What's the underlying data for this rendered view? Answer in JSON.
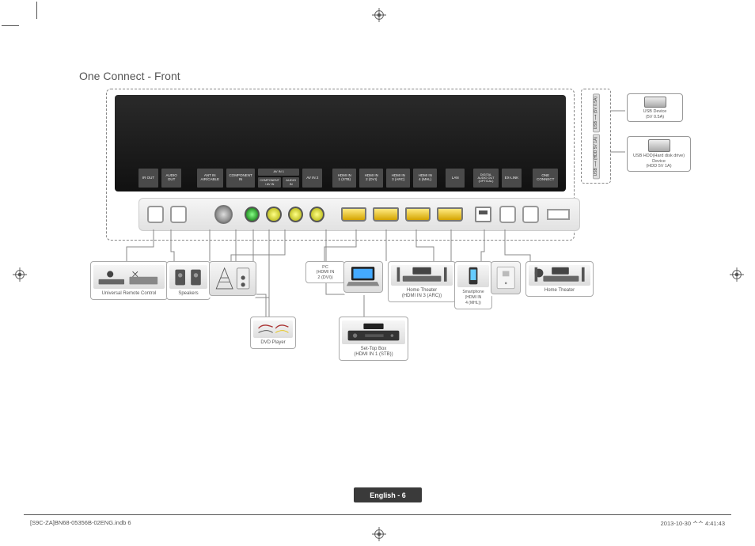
{
  "title": "One Connect - Front",
  "port_labels": {
    "ir": "IR OUT",
    "audio": "AUDIO\nOUT",
    "ant": "ANT IN\nAIR/CABLE",
    "comp": "COMPONENT\nIN",
    "avin1_grp": "AV IN 1",
    "avin1_a": "COMPONENT\n/ AV IN",
    "avin1_b": "AUDIO IN",
    "avin2": "AV IN 2",
    "h1": "HDMI IN\n1 (STB)",
    "h2": "HDMI IN\n2 (DVI)",
    "h3": "HDMI IN\n3 (ARC)",
    "h4": "HDMI IN\n4 (MHL)",
    "lan": "LAN",
    "opt": "DIGITAL\nAUDIO OUT\n(OPTICAL)",
    "ex": "EX-LINK",
    "oc": "ONE\nCONNECT"
  },
  "usb": {
    "port1": "USB ⟶ (5V 0.5A)",
    "port2": "USB ⟶ (HDD 5V 1A)",
    "dev1": "USB Device\n(5V 0.5A)",
    "dev2": "USB HDD(Hard disk drive) Device\n(HDD 5V 1A)"
  },
  "devices": {
    "urc": "Universal Remote Control",
    "speakers": "Speakers",
    "pc": "PC\n(HDMI IN\n2 (DVI))",
    "ht_arc": "Home Theater\n(HDMI IN 3 (ARC))",
    "phone": "Smartphone\n(HDMI IN\n4 (MHL))",
    "ht": "Home Theater",
    "dvd": "DVD Player",
    "stb": "Set-Top Box\n(HDMI IN 1 (STB))"
  },
  "footer": {
    "page": "English - 6",
    "left": "[S9C-ZA]BN68-05356B-02ENG.indb   6",
    "right": "2013-10-30   ᄉᄉ 4:41:43"
  }
}
